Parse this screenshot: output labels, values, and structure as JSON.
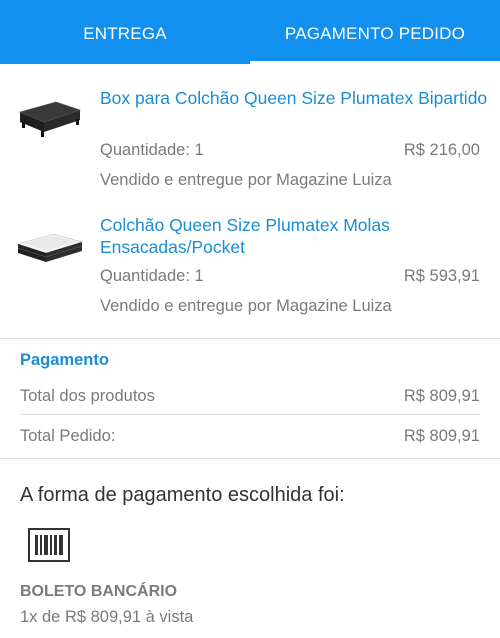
{
  "tabs": [
    {
      "label": "ENTREGA",
      "active": false
    },
    {
      "label": "PAGAMENTO PEDIDO",
      "active": true
    }
  ],
  "products": [
    {
      "name": "Box para Colchão Queen Size Plumatex Bipartido",
      "quantity": "Quantidade: 1",
      "price": "R$ 216,00",
      "seller": "Vendido e entregue por Magazine Luiza",
      "image": "box-bed-base-image"
    },
    {
      "name": "Colchão Queen Size Plumatex Molas Ensacadas/Pocket",
      "quantity": "Quantidade: 1",
      "price": "R$ 593,91",
      "seller": "Vendido e entregue por Magazine Luiza",
      "image": "mattress-image"
    }
  ],
  "payment": {
    "title": "Pagamento",
    "rows": [
      {
        "label": "Total dos produtos",
        "value": "R$ 809,91"
      },
      {
        "label": "Total Pedido:",
        "value": "R$ 809,91"
      }
    ]
  },
  "method": {
    "heading": "A forma de pagamento escolhida foi:",
    "icon": "barcode-icon",
    "name": "BOLETO BANCÁRIO",
    "detail": "1x de R$ 809,91 à vista"
  },
  "colors": {
    "header": "#1190f0",
    "link": "#1a8ed3",
    "text_muted": "#7a7a7a"
  }
}
